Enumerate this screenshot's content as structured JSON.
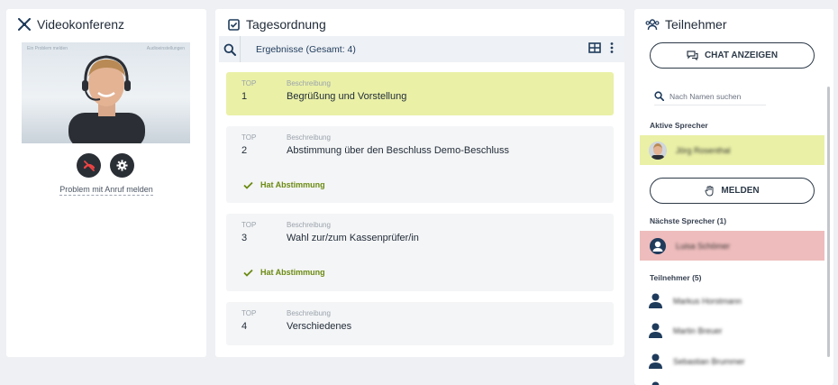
{
  "video": {
    "title": "Videokonferenz",
    "overlay_left": "Ein Problem melden",
    "overlay_right": "Audioeinstellungen",
    "report_link": "Problem mit Anruf melden"
  },
  "agenda": {
    "title": "Tagesordnung",
    "results_label": "Ergebnisse (Gesamt: 4)",
    "col_top": "TOP",
    "col_desc": "Beschreibung",
    "items": [
      {
        "top": "1",
        "desc": "Begrüßung und Vorstellung",
        "vote": ""
      },
      {
        "top": "2",
        "desc": "Abstimmung über den Beschluss Demo-Beschluss",
        "vote": "Hat Abstimmung"
      },
      {
        "top": "3",
        "desc": "Wahl zur/zum Kassenprüfer/in",
        "vote": "Hat Abstimmung"
      },
      {
        "top": "4",
        "desc": "Verschiedenes",
        "vote": ""
      }
    ]
  },
  "participants": {
    "title": "Teilnehmer",
    "chat_button": "CHAT ANZEIGEN",
    "search_placeholder": "Nach Namen suchen",
    "active_label": "Aktive Sprecher",
    "active_speaker": "Jörg Rosenthal",
    "raise_button": "MELDEN",
    "next_label": "Nächste Sprecher (1)",
    "next_speaker": "Luisa Schömer",
    "list_label": "Teilnehmer (5)",
    "list": [
      "Markus Horstmann",
      "Martin Breuer",
      "Sebastian Brummer"
    ]
  },
  "colors": {
    "active_item": "#eaf0a6",
    "active_speaker_bg": "#eaf0a6",
    "next_speaker_bg": "#eebcbc",
    "vote_text": "#6b8a12",
    "accent_dark": "#1f3b5c"
  }
}
